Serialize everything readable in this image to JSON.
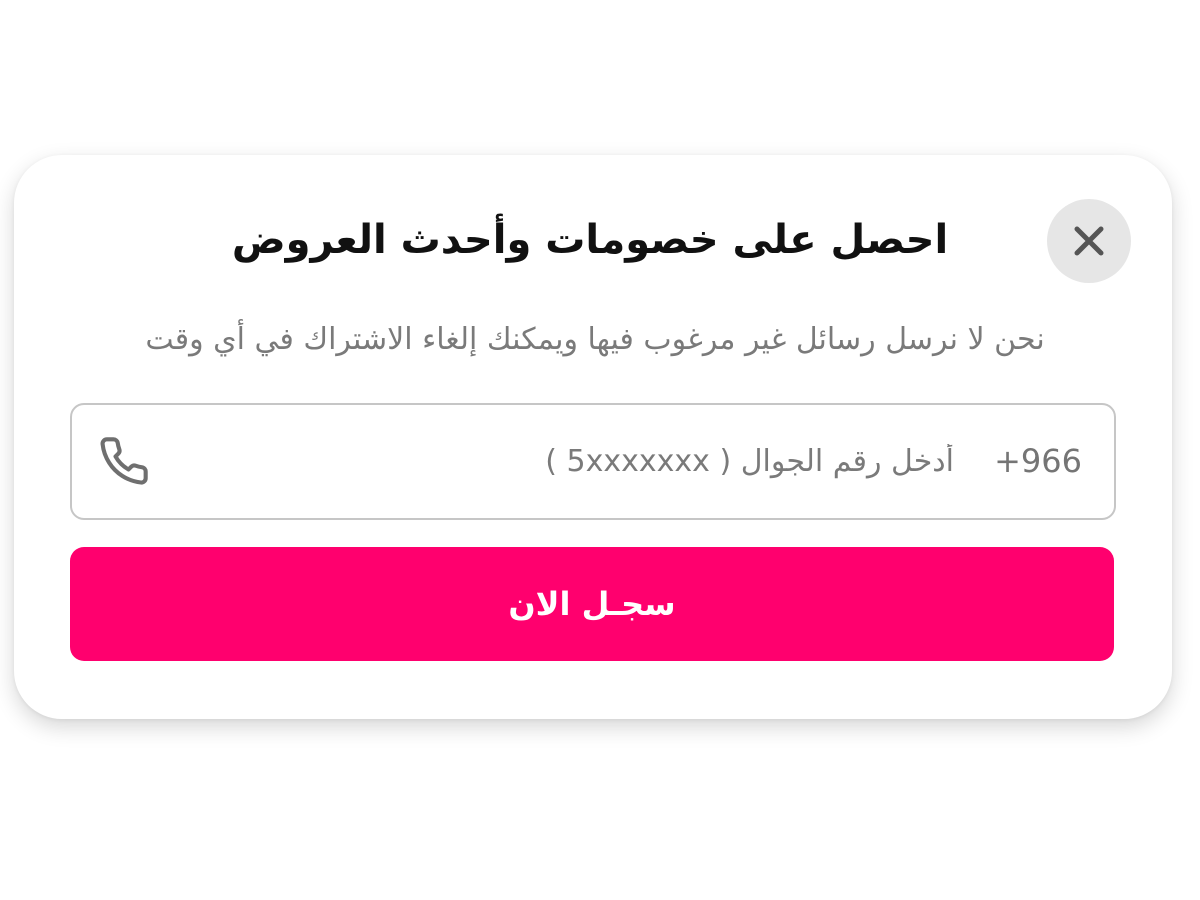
{
  "modal": {
    "title": "احصل على خصومات وأحدث العروض",
    "subtitle": "نحن لا نرسل رسائل غير مرغوب فيها ويمكنك إلغاء الاشتراك في أي وقت",
    "close_icon": "close-icon"
  },
  "phone": {
    "country_code": "+966",
    "placeholder": "أدخل رقم الجوال ( 5xxxxxxx )",
    "value": "",
    "icon": "phone-icon"
  },
  "submit": {
    "label": "سجـل الان"
  },
  "colors": {
    "accent": "#ff006e",
    "close_bg": "#e6e6e6",
    "border": "#c6c6c6",
    "muted_text": "#7a7a7a"
  }
}
